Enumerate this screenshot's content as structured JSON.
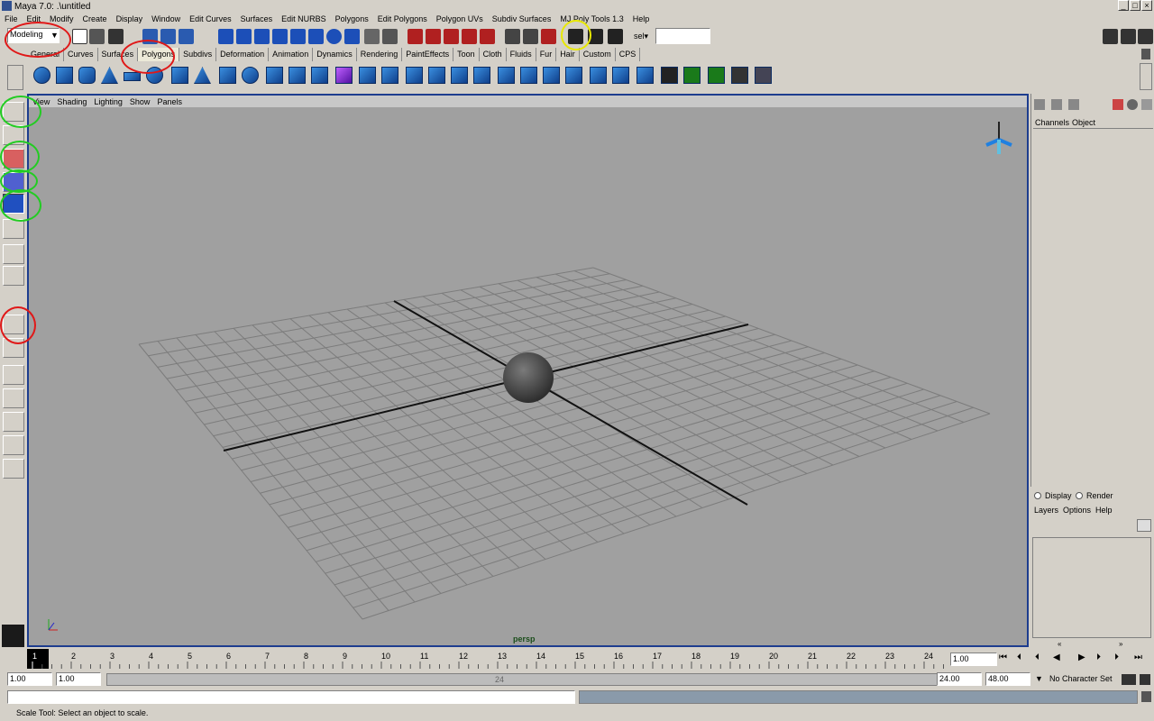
{
  "window": {
    "title": "Maya 7.0: .\\untitled",
    "btn_min": "_",
    "btn_max": "□",
    "btn_close": "×"
  },
  "menubar": [
    "File",
    "Edit",
    "Modify",
    "Create",
    "Display",
    "Window",
    "Edit Curves",
    "Surfaces",
    "Edit NURBS",
    "Polygons",
    "Edit Polygons",
    "Polygon UVs",
    "Subdiv Surfaces",
    "MJ Poly Tools 1.3",
    "Help"
  ],
  "toolbar": {
    "mode_select": "Modeling",
    "sel_label": "sel▾",
    "sel_value": ""
  },
  "shelf_tabs": [
    "General",
    "Curves",
    "Surfaces",
    "Polygons",
    "Subdivs",
    "Deformation",
    "Animation",
    "Dynamics",
    "Rendering",
    "PaintEffects",
    "Toon",
    "Cloth",
    "Fluids",
    "Fur",
    "Hair",
    "Custom",
    "CPS"
  ],
  "active_shelf_tab": "Polygons",
  "panel_menu": [
    "View",
    "Shading",
    "Lighting",
    "Show",
    "Panels"
  ],
  "viewport": {
    "camera": "persp"
  },
  "channel_box": {
    "tabs": [
      "Channels",
      "Object"
    ],
    "display_label": "Display",
    "render_label": "Render",
    "layer_menu": [
      "Layers",
      "Options",
      "Help"
    ]
  },
  "timeline": {
    "ticks": [
      "1",
      "2",
      "3",
      "4",
      "5",
      "6",
      "7",
      "8",
      "9",
      "10",
      "11",
      "12",
      "13",
      "14",
      "15",
      "16",
      "17",
      "18",
      "19",
      "20",
      "21",
      "22",
      "23",
      "24"
    ],
    "current": "1.00"
  },
  "range": {
    "start": "1.00",
    "start2": "1.00",
    "inner_end": "24",
    "end": "24.00",
    "end2": "48.00",
    "char_set": "No Character Set"
  },
  "status": {
    "help_line": "Scale Tool: Select an object to scale."
  },
  "colors": {
    "viewport_bg": "#a0a0a0",
    "viewport_border": "#1d3d8f",
    "ui_bg": "#d4d0c8"
  }
}
